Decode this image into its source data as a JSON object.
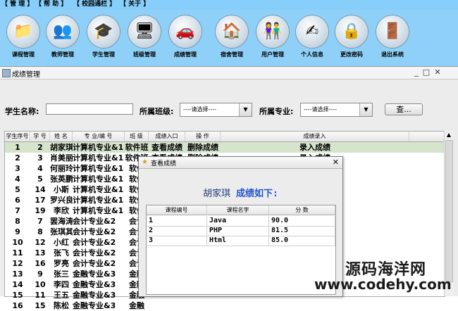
{
  "menubar": [
    "【 管  理 】",
    "【 帮  助 】",
    "【 校园通栏 】",
    "【 关于 】"
  ],
  "toolbar": [
    {
      "label": "课程管理",
      "icon": "course-icon",
      "glyph": "📁"
    },
    {
      "label": "教师管理",
      "icon": "teacher-icon",
      "glyph": "👥"
    },
    {
      "label": "学生管理",
      "icon": "student-icon",
      "glyph": "🎓"
    },
    {
      "label": "班级管理",
      "icon": "class-icon",
      "glyph": "🖥"
    },
    {
      "label": "成绩管理",
      "icon": "grade-icon",
      "glyph": "🚗"
    },
    {
      "label": "宿舍管理",
      "icon": "dormitory-icon",
      "glyph": "🏠"
    },
    {
      "label": "用户管理",
      "icon": "users-icon",
      "glyph": "👫"
    },
    {
      "label": "个人信息",
      "icon": "personal-info-icon",
      "glyph": "✍"
    },
    {
      "label": "更改密码",
      "icon": "password-icon",
      "glyph": "🔒"
    },
    {
      "label": "退出系统",
      "icon": "exit-icon",
      "glyph": "🚪"
    }
  ],
  "window": {
    "title": "成绩管理"
  },
  "search": {
    "name_label": "学生名称:",
    "name_value": "",
    "class_label": "所属班级:",
    "class_value": "----请选择----",
    "major_label": "所属专业:",
    "major_value": "----请选择----",
    "query_button": "查..."
  },
  "table": {
    "columns": [
      "学生序号",
      "学 号",
      "姓 名",
      "专 业/编 号",
      "班 级",
      "成绩入口",
      "操 作",
      "成绩录入"
    ],
    "rows": [
      [
        "1",
        "2",
        "胡家琪",
        "计算机专业&1",
        "软件班",
        "查看成绩",
        "删除成绩",
        "录入成绩"
      ],
      [
        "2",
        "3",
        "肖美丽",
        "计算机专业&1",
        "软件班",
        "查看成绩",
        "删除成绩",
        "录入成绩"
      ],
      [
        "3",
        "4",
        "何丽玲",
        "计算机专业&1",
        "软件",
        "",
        "",
        ""
      ],
      [
        "4",
        "5",
        "张英鹏",
        "计算机专业&1",
        "软件",
        "",
        "",
        ""
      ],
      [
        "5",
        "14",
        "小斯",
        "计算机专业&1",
        "软件",
        "",
        "",
        ""
      ],
      [
        "6",
        "17",
        "罗兴良",
        "计算机专业&1",
        "软件",
        "",
        "",
        ""
      ],
      [
        "7",
        "19",
        "李欣",
        "计算机专业&1",
        "软件",
        "",
        "",
        ""
      ],
      [
        "8",
        "7",
        "罢海涛",
        "会计专业&2",
        "会计",
        "",
        "",
        ""
      ],
      [
        "9",
        "8",
        "张琪其",
        "会计专业&2",
        "会计",
        "",
        "",
        ""
      ],
      [
        "10",
        "12",
        "小红",
        "会计专业&2",
        "会计",
        "",
        "",
        ""
      ],
      [
        "11",
        "13",
        "张飞",
        "会计专业&2",
        "会计",
        "",
        "",
        ""
      ],
      [
        "12",
        "16",
        "罗亮",
        "会计专业&2",
        "会计",
        "",
        "",
        ""
      ],
      [
        "13",
        "9",
        "张三",
        "金融专业&3",
        "金融",
        "",
        "",
        ""
      ],
      [
        "14",
        "10",
        "李四",
        "金融专业&3",
        "金融",
        "",
        "",
        ""
      ],
      [
        "15",
        "11",
        "王五",
        "金融专业&3",
        "金融",
        "",
        "",
        ""
      ],
      [
        "16",
        "15",
        "陈松",
        "金融专业&3",
        "金融",
        "",
        "",
        ""
      ]
    ]
  },
  "dialog": {
    "title": "查看成绩",
    "student_name": "胡家琪",
    "heading_suffix": "成绩如下:",
    "columns": [
      "课程编号",
      "课程名字",
      "分  数"
    ],
    "rows": [
      [
        "1",
        "Java",
        "90.0"
      ],
      [
        "2",
        "PHP",
        "81.5"
      ],
      [
        "3",
        "Html",
        "85.0"
      ]
    ]
  },
  "watermark": {
    "line1": "源码海洋网",
    "line2": "www.codehy.com"
  }
}
